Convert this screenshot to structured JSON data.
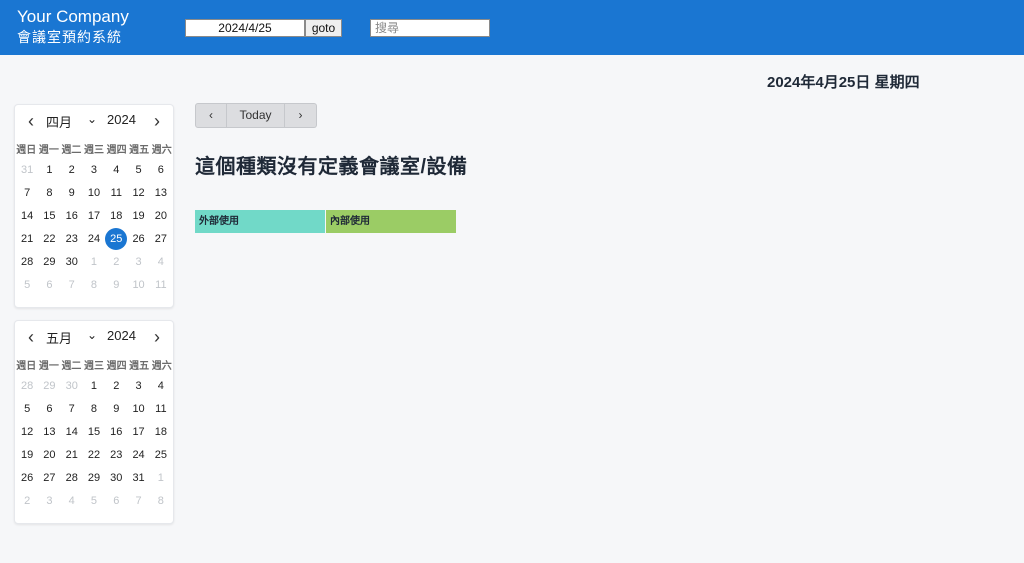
{
  "header": {
    "company": "Your Company",
    "system_name": "會議室預約系統",
    "date_value": "2024/4/25",
    "goto_label": "goto",
    "search_placeholder": "搜尋"
  },
  "current_date_heading": "2024年4月25日 星期四",
  "weekdays": [
    "週日",
    "週一",
    "週二",
    "週三",
    "週四",
    "週五",
    "週六"
  ],
  "calendars": [
    {
      "month": "四月",
      "year": "2024",
      "weeks": [
        [
          [
            "31",
            true
          ],
          [
            "1",
            false
          ],
          [
            "2",
            false
          ],
          [
            "3",
            false
          ],
          [
            "4",
            false
          ],
          [
            "5",
            false
          ],
          [
            "6",
            false
          ]
        ],
        [
          [
            "7",
            false
          ],
          [
            "8",
            false
          ],
          [
            "9",
            false
          ],
          [
            "10",
            false
          ],
          [
            "11",
            false
          ],
          [
            "12",
            false
          ],
          [
            "13",
            false
          ]
        ],
        [
          [
            "14",
            false
          ],
          [
            "15",
            false
          ],
          [
            "16",
            false
          ],
          [
            "17",
            false
          ],
          [
            "18",
            false
          ],
          [
            "19",
            false
          ],
          [
            "20",
            false
          ]
        ],
        [
          [
            "21",
            false
          ],
          [
            "22",
            false
          ],
          [
            "23",
            false
          ],
          [
            "24",
            false
          ],
          [
            "25",
            false,
            true
          ],
          [
            "26",
            false
          ],
          [
            "27",
            false
          ]
        ],
        [
          [
            "28",
            false
          ],
          [
            "29",
            false
          ],
          [
            "30",
            false
          ],
          [
            "1",
            true
          ],
          [
            "2",
            true
          ],
          [
            "3",
            true
          ],
          [
            "4",
            true
          ]
        ],
        [
          [
            "5",
            true
          ],
          [
            "6",
            true
          ],
          [
            "7",
            true
          ],
          [
            "8",
            true
          ],
          [
            "9",
            true
          ],
          [
            "10",
            true
          ],
          [
            "11",
            true
          ]
        ]
      ]
    },
    {
      "month": "五月",
      "year": "2024",
      "weeks": [
        [
          [
            "28",
            true
          ],
          [
            "29",
            true
          ],
          [
            "30",
            true
          ],
          [
            "1",
            false
          ],
          [
            "2",
            false
          ],
          [
            "3",
            false
          ],
          [
            "4",
            false
          ]
        ],
        [
          [
            "5",
            false
          ],
          [
            "6",
            false
          ],
          [
            "7",
            false
          ],
          [
            "8",
            false
          ],
          [
            "9",
            false
          ],
          [
            "10",
            false
          ],
          [
            "11",
            false
          ]
        ],
        [
          [
            "12",
            false
          ],
          [
            "13",
            false
          ],
          [
            "14",
            false
          ],
          [
            "15",
            false
          ],
          [
            "16",
            false
          ],
          [
            "17",
            false
          ],
          [
            "18",
            false
          ]
        ],
        [
          [
            "19",
            false
          ],
          [
            "20",
            false
          ],
          [
            "21",
            false
          ],
          [
            "22",
            false
          ],
          [
            "23",
            false
          ],
          [
            "24",
            false
          ],
          [
            "25",
            false
          ]
        ],
        [
          [
            "26",
            false
          ],
          [
            "27",
            false
          ],
          [
            "28",
            false
          ],
          [
            "29",
            false
          ],
          [
            "30",
            false
          ],
          [
            "31",
            false
          ],
          [
            "1",
            true
          ]
        ],
        [
          [
            "2",
            true
          ],
          [
            "3",
            true
          ],
          [
            "4",
            true
          ],
          [
            "5",
            true
          ],
          [
            "6",
            true
          ],
          [
            "7",
            true
          ],
          [
            "8",
            true
          ]
        ]
      ]
    }
  ],
  "toolbar": {
    "prev_icon": "‹",
    "today_label": "Today",
    "next_icon": "›"
  },
  "no_definition_message": "這個種類沒有定義會議室/設備",
  "legend": {
    "external": {
      "label": "外部使用",
      "color": "#71d9c8"
    },
    "internal": {
      "label": "內部使用",
      "color": "#9bcc65"
    }
  },
  "colors": {
    "header_bg": "#1a76d2",
    "selected_day": "#1a76d2"
  }
}
